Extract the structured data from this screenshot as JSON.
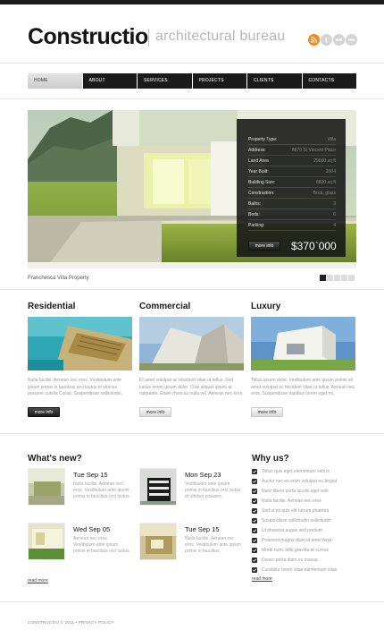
{
  "header": {
    "logo": "Constructio",
    "tagline": "architectural bureau"
  },
  "social": [
    {
      "icon": "rss-icon",
      "color": "#f08a24"
    },
    {
      "icon": "twitter-icon",
      "color": "#cfcfcf"
    },
    {
      "icon": "flickr-icon",
      "color": "#cfcfcf"
    },
    {
      "icon": "delicious-icon",
      "color": "#cfcfcf"
    }
  ],
  "nav": {
    "items": [
      "Home",
      "About",
      "Services",
      "Projects",
      "Clients",
      "Contacts"
    ],
    "active": "Home"
  },
  "slider": {
    "property": [
      {
        "key": "Property Type:",
        "value": "Villa"
      },
      {
        "key": "Address:",
        "value": "8870 St Vincent Place"
      },
      {
        "key": "Land Area",
        "value": "29000 sq ft"
      },
      {
        "key": "Year Built:",
        "value": "2004"
      },
      {
        "key": "Building Size:",
        "value": "8800 sq ft"
      },
      {
        "key": "Construction:",
        "value": "Brick, glass"
      },
      {
        "key": "Baths:",
        "value": "3"
      },
      {
        "key": "Beds:",
        "value": "6"
      },
      {
        "key": "Parking:",
        "value": "4"
      }
    ],
    "more_label": "more info",
    "price": "$370`000",
    "caption": "Franchesca Villa Property",
    "pages": 5,
    "active_page": 1
  },
  "columns": [
    {
      "title": "Residential",
      "text": "Nulla facilisi. Aenean nec eros. Vestibulum ante ipsum primis in faucibus orci luctus et ultrices posuere cubilia Curae; Suspendisse sollicitudin.",
      "more": "more info"
    },
    {
      "title": "Commercial",
      "text": "Et amet volutpat ac tincidunt vitae ut tellus. Sed luctus lorem ipsum dolor. Cras aliquet ipsum at vulputate. Etiam rhoncus nulla vel. Aenean nec eros.",
      "more": "more info"
    },
    {
      "title": "Luxury",
      "text": "Tellus ipsum dolor. Vestibulum ante ipsum primis sit amet volutpat ac tincidunt vitae ut tellus. Aenean nec eros. Suspendisse dapibus lorem eget mi.",
      "more": "more info"
    }
  ],
  "news": {
    "title": "What's new?",
    "items": [
      {
        "date": "Tue Sep 15",
        "text": "Nulla facilisi. Aenean nec eros. Vestibulum ante ipsum primis in faucibus orci luctus."
      },
      {
        "date": "Mon Sep 23",
        "text": "Vestibulum ante ipsum primis in faucibus orci luctus et ultrices posuere."
      },
      {
        "date": "Wed Sep 05",
        "text": "Aenean nec eros. Vestibulum ante ipsum primis in faucibus orci luctus."
      },
      {
        "date": "Tue Sep 15",
        "text": "Nulla facilisi. Aenean nec eros. Vestibulum ante ipsum primis in faucibus."
      }
    ],
    "read_more": "read more"
  },
  "why": {
    "title": "Why us?",
    "items": [
      "Tellus quis eget elementum velit in",
      "Auctor nec eu enim volutpat eu fergiat",
      "Nunc libero porta iaculis eget velit",
      "Nulla facilisi. Aenean nec eros",
      "Sed ut mi quis elit rutrum pharetra",
      "Suspendisse sollicitudin sollicitudin",
      "Ut pharetra augue sed pretium",
      "Praesent magna diam id amet ferat",
      "Morbi nunc odio gravida at cursus",
      "Donec porta diam eu massa",
      "Curabitur lorem vitae elementum vitae"
    ],
    "read_more": "read more"
  },
  "footer": {
    "text": "CONSTRUCTIO © 2011 • PRIVACY POLICY"
  }
}
